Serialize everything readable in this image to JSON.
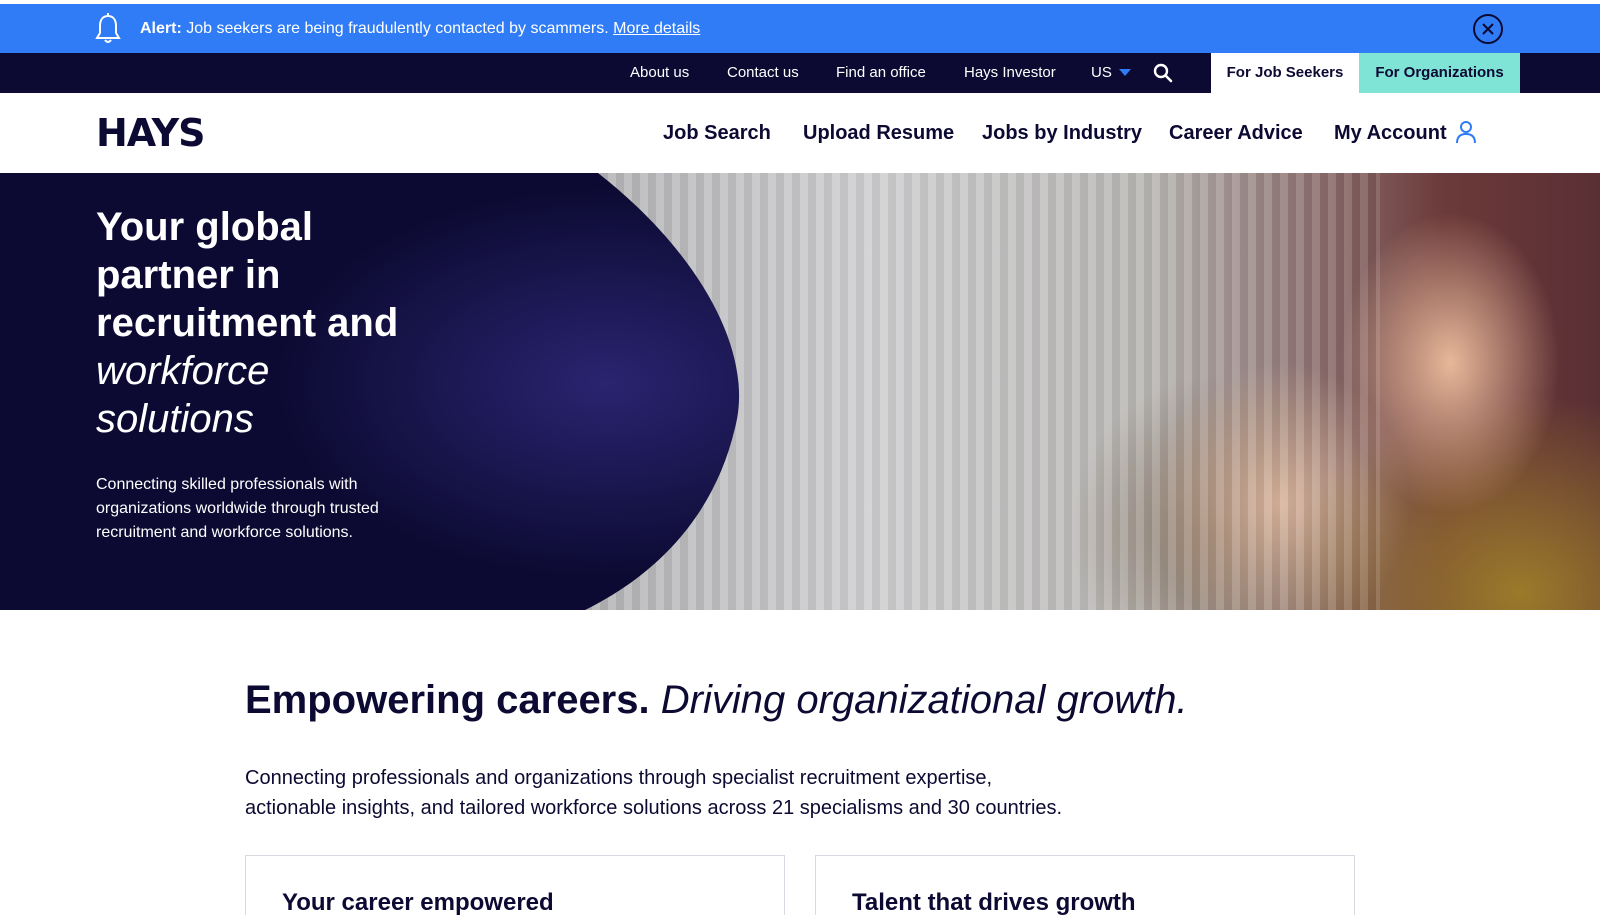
{
  "alert": {
    "label": "Alert:",
    "message": " Job seekers are being fraudulently contacted by scammers. ",
    "link": "More details"
  },
  "utility_nav": {
    "links": [
      "About us",
      "Contact us",
      "Find an office",
      "Hays Investor",
      "US"
    ],
    "tabs": {
      "job_seekers": "For Job Seekers",
      "organizations": "For Organizations"
    }
  },
  "main_nav": {
    "logo": "HAYS",
    "items": [
      "Job Search",
      "Upload Resume",
      "Jobs by Industry",
      "Career Advice",
      "My Account"
    ]
  },
  "hero": {
    "title_strong": "Your global partner in recruitment and",
    "title_italic": "workforce solutions",
    "subtitle": "Connecting skilled professionals with organizations worldwide through trusted recruitment and workforce solutions."
  },
  "intro": {
    "heading_strong": "Empowering careers.",
    "heading_italic": "Driving organizational growth.",
    "body": "Connecting professionals and organizations through specialist recruitment expertise, actionable insights, and tailored workforce solutions across 21 specialisms and 30 countries."
  },
  "cards": [
    {
      "title": "Your career empowered"
    },
    {
      "title": "Talent that drives growth"
    }
  ],
  "colors": {
    "alert_blue": "#2f7cf6",
    "navy": "#0c0a32",
    "mint": "#7fe4d6"
  },
  "icons": {
    "alert": "bell-icon",
    "close": "close-icon",
    "search": "search-icon",
    "region": "chevron-down-icon",
    "account": "user-icon"
  }
}
